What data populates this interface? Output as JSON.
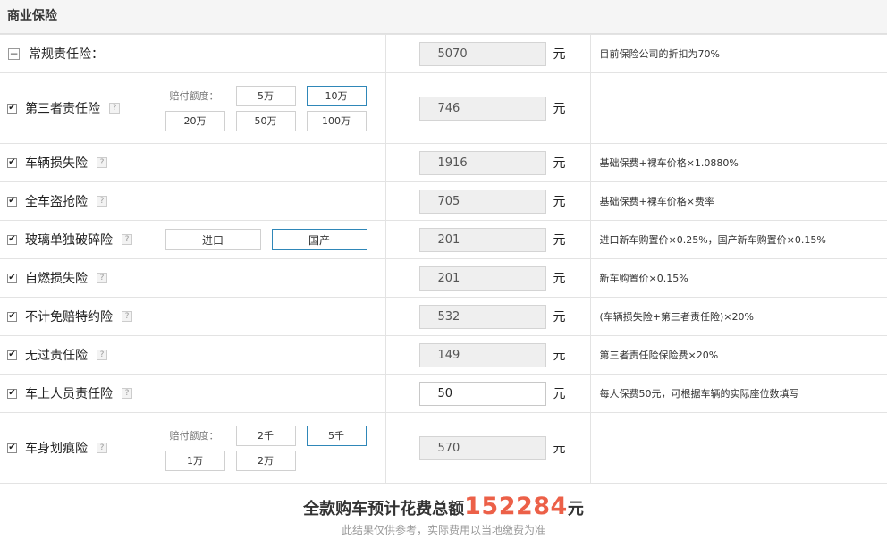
{
  "header": {
    "title": "商业保险"
  },
  "rows": [
    {
      "name": "常规责任险：",
      "price": "5070",
      "unit": "元",
      "formula": "目前保险公司的折扣为70%"
    },
    {
      "name": "第三者责任险",
      "help": "?",
      "price": "746",
      "unit": "元",
      "formula": "",
      "options_label": "赔付额度：",
      "options": [
        "5万",
        "10万",
        "20万",
        "50万",
        "100万"
      ],
      "selected": "10万"
    },
    {
      "name": "车辆损失险",
      "help": "?",
      "price": "1916",
      "unit": "元",
      "formula": "基础保费+裸车价格×1.0880%"
    },
    {
      "name": "全车盗抢险",
      "help": "?",
      "price": "705",
      "unit": "元",
      "formula": "基础保费+裸车价格×费率"
    },
    {
      "name": "玻璃单独破碎险",
      "help": "?",
      "price": "201",
      "unit": "元",
      "formula": "进口新车购置价×0.25%，国产新车购置价×0.15%",
      "options": [
        "进口",
        "国产"
      ],
      "selected": "国产"
    },
    {
      "name": "自燃损失险",
      "help": "?",
      "price": "201",
      "unit": "元",
      "formula": "新车购置价×0.15%"
    },
    {
      "name": "不计免赔特约险",
      "help": "?",
      "price": "532",
      "unit": "元",
      "formula": "(车辆损失险+第三者责任险)×20%"
    },
    {
      "name": "无过责任险",
      "help": "?",
      "price": "149",
      "unit": "元",
      "formula": "第三者责任险保险费×20%"
    },
    {
      "name": "车上人员责任险",
      "help": "?",
      "price": "50",
      "unit": "元",
      "formula": "每人保费50元，可根据车辆的实际座位数填写"
    },
    {
      "name": "车身划痕险",
      "help": "?",
      "price": "570",
      "unit": "元",
      "formula": "",
      "options_label": "赔付额度：",
      "options": [
        "2千",
        "5千",
        "1万",
        "2万"
      ],
      "selected": "5千"
    }
  ],
  "footer": {
    "total_prefix": "全款购车预计花费总额",
    "total_value": "152284",
    "total_suffix": "元",
    "note": "此结果仅供参考，实际费用以当地缴费为准"
  },
  "colors": {
    "accent": "#ec6048",
    "selected_border": "#2f87b8"
  },
  "icons": {
    "checkbox": "checked-checkbox-icon",
    "collapse": "minus-square-icon",
    "help": "question-icon"
  }
}
